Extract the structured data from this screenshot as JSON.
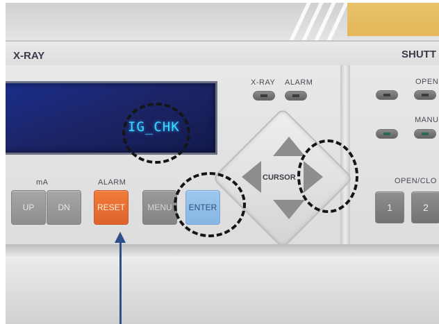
{
  "panel": {
    "sections": {
      "xray": "X-RAY",
      "shutter": "SHUTT"
    },
    "display": {
      "text": "IG_CHK"
    },
    "indicators": {
      "xray": "X-RAY",
      "alarm": "ALARM",
      "open": "OPEN",
      "manual": "MANU"
    },
    "groups": {
      "ma": "mA",
      "alarm": "ALARM",
      "open_close": "OPEN/CLO"
    },
    "buttons": {
      "up": "UP",
      "dn": "DN",
      "reset": "RESET",
      "menu": "MENU",
      "enter": "ENTER",
      "cursor": "CURSOR",
      "shutter_1": "1",
      "shutter_2": "2"
    }
  },
  "colors": {
    "lcd_background": "#1c2466",
    "lcd_text": "#3ad8ff",
    "reset_button": "#e8692f",
    "enter_button": "#8fbce8",
    "annotation_arrow": "#2f4f8a",
    "hazard_badge": "#e6bd62"
  },
  "icons": {
    "radiation": "radiation-trefoil-icon",
    "arrows": [
      "arrow-up-icon",
      "arrow-down-icon",
      "arrow-left-icon",
      "arrow-right-icon"
    ]
  }
}
